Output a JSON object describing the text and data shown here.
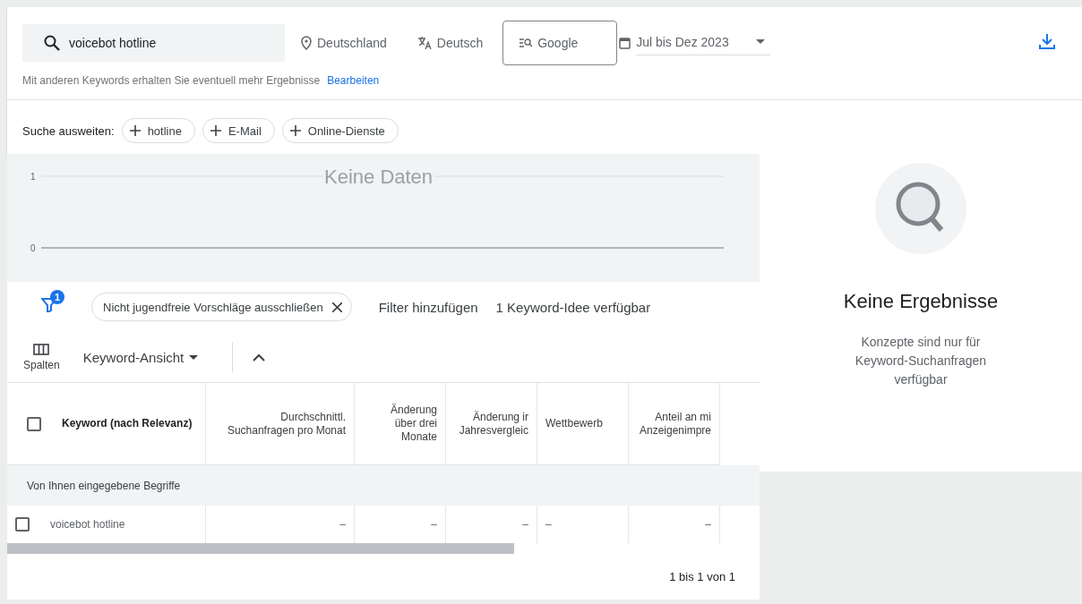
{
  "search": {
    "value": "voicebot hotline",
    "location": "Deutschland",
    "language": "Deutsch",
    "network": "Google",
    "date_range": "Jul bis Dez 2023"
  },
  "hint": {
    "text": "Mit anderen Keywords erhalten Sie eventuell mehr Ergebnisse",
    "link": "Bearbeiten"
  },
  "expand": {
    "label": "Suche ausweiten:",
    "chips": [
      "hotline",
      "E-Mail",
      "Online-Dienste"
    ]
  },
  "chart": {
    "message": "Keine Daten",
    "axis_labels": [
      "1",
      "0"
    ]
  },
  "filters": {
    "badge": "1",
    "chips": [
      {
        "label": "Nicht jugendfreie Vorschläge ausschließen"
      }
    ],
    "add_filter": "Filter hinzufügen",
    "count": "1 Keyword-Idee verfügbar"
  },
  "toolbar": {
    "columns": "Spalten",
    "view": "Keyword-Ansicht"
  },
  "table": {
    "select_all_checked": false,
    "columns": [
      {
        "label": "Keyword (nach Relevanz)",
        "kind": "keyword"
      },
      {
        "label": "Durchschnittl.\nSuchanfragen pro Monat",
        "kind": "number"
      },
      {
        "label": "Änderung\nüber drei\nMonate",
        "kind": "number"
      },
      {
        "label": "Änderung ir\nJahresvergleic",
        "kind": "number"
      },
      {
        "label": "Wettbewerb",
        "kind": "text"
      },
      {
        "label": "Anteil an mi\nAnzeigenimpre",
        "kind": "number"
      }
    ],
    "group": "Von Ihnen eingegebene Begriffe",
    "rows": [
      {
        "checked": false,
        "cells": [
          "voicebot hotline",
          "–",
          "–",
          "–",
          "–",
          "–"
        ]
      }
    ],
    "pagination": "1 bis 1 von 1"
  },
  "side_panel": {
    "title": "Keine Ergebnisse",
    "text": "Konzepte sind nur für Keyword-Suchanfragen verfügbar"
  }
}
